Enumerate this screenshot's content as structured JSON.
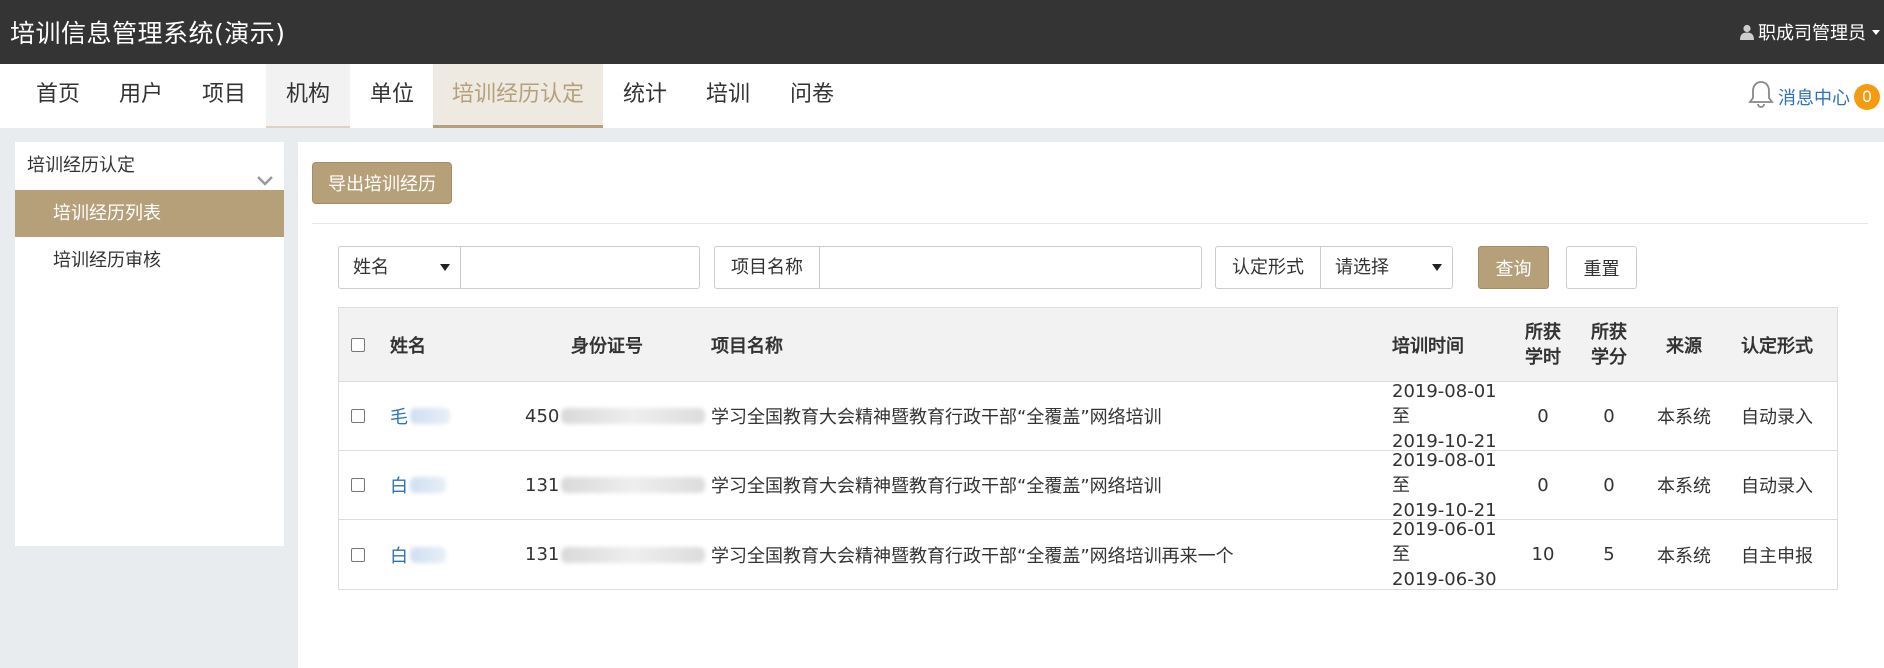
{
  "app": {
    "title": "培训信息管理系统(演示)",
    "user": "职成司管理员"
  },
  "nav": {
    "items": [
      "首页",
      "用户",
      "项目",
      "机构",
      "单位",
      "培训经历认定",
      "统计",
      "培训",
      "问卷"
    ],
    "messages_label": "消息中心",
    "messages_count": "0"
  },
  "sidebar": {
    "group": "培训经历认定",
    "items": [
      "培训经历列表",
      "培训经历审核"
    ]
  },
  "toolbar": {
    "export_label": "导出培训经历"
  },
  "filters": {
    "name_select": "姓名",
    "project_label": "项目名称",
    "form_label": "认定形式",
    "form_select": "请选择",
    "query_label": "查询",
    "reset_label": "重置"
  },
  "table": {
    "headers": {
      "name": "姓名",
      "id": "身份证号",
      "project": "项目名称",
      "time": "培训时间",
      "hours_1": "所获",
      "hours_2": "学时",
      "credits_1": "所获",
      "credits_2": "学分",
      "source": "来源",
      "form": "认定形式"
    },
    "rows": [
      {
        "name": "毛",
        "id": "450",
        "project": "学习全国教育大会精神暨教育行政干部“全覆盖”网络培训",
        "time_start": "2019-08-01至",
        "time_end": "2019-10-21",
        "hours": "0",
        "credits": "0",
        "source": "本系统",
        "form": "自动录入"
      },
      {
        "name": "白",
        "id": "131",
        "project": "学习全国教育大会精神暨教育行政干部“全覆盖”网络培训",
        "time_start": "2019-08-01至",
        "time_end": "2019-10-21",
        "hours": "0",
        "credits": "0",
        "source": "本系统",
        "form": "自动录入"
      },
      {
        "name": "白",
        "id": "131",
        "project": "学习全国教育大会精神暨教育行政干部“全覆盖”网络培训再来一个",
        "time_start": "2019-06-01至",
        "time_end": "2019-06-30",
        "hours": "10",
        "credits": "5",
        "source": "本系统",
        "form": "自主申报"
      }
    ]
  },
  "icons": {
    "user": "user-icon",
    "bell": "bell-icon",
    "chevron": "chevron-down-icon"
  },
  "colors": {
    "accent": "#b5a07a",
    "topbar": "#343434",
    "link": "#2d73b8",
    "badge": "#f39c12"
  }
}
